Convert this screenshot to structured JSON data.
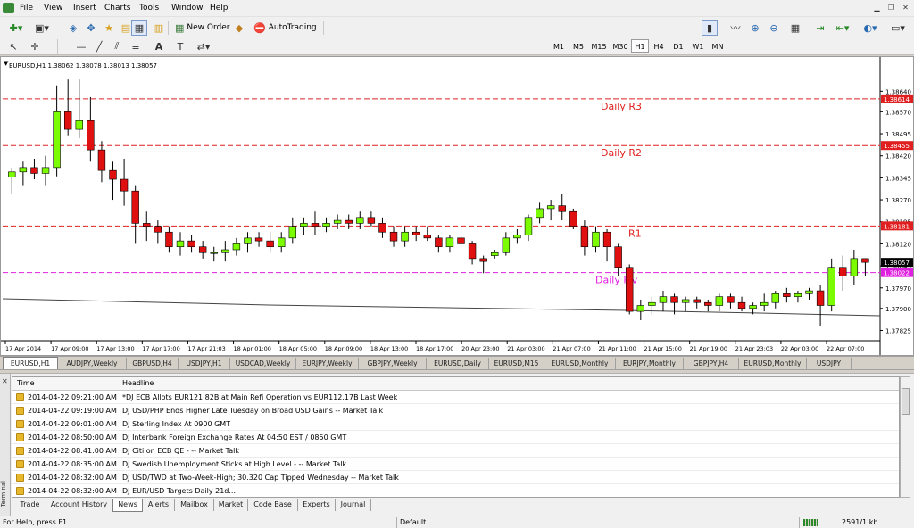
{
  "menu": [
    "File",
    "View",
    "Insert",
    "Charts",
    "Tools",
    "Window",
    "Help"
  ],
  "toolbar": {
    "new_order": "New Order",
    "autotrading": "AutoTrading"
  },
  "timeframes": [
    "M1",
    "M5",
    "M15",
    "M30",
    "H1",
    "H4",
    "D1",
    "W1",
    "MN"
  ],
  "active_timeframe": "H1",
  "chart": {
    "header": "EURUSD,H1  1.38062 1.38078 1.38013 1.38057"
  },
  "chart_data": {
    "type": "candlestick",
    "symbol": "EURUSD",
    "timeframe": "H1",
    "ylim": [
      1.3779,
      1.3872
    ],
    "y_ticks": [
      "1.38640",
      "1.38570",
      "1.38495",
      "1.38420",
      "1.38345",
      "1.38270",
      "1.38195",
      "1.38120",
      "1.38045",
      "1.37970",
      "1.37900",
      "1.37825"
    ],
    "x_ticks": [
      "17 Apr 2014",
      "17 Apr 09:00",
      "17 Apr 13:00",
      "17 Apr 17:00",
      "17 Apr 21:03",
      "18 Apr 01:00",
      "18 Apr 05:00",
      "18 Apr 09:00",
      "18 Apr 13:00",
      "18 Apr 17:00",
      "20 Apr 23:00",
      "21 Apr 03:00",
      "21 Apr 07:00",
      "21 Apr 11:00",
      "21 Apr 15:00",
      "21 Apr 19:00",
      "21 Apr 23:03",
      "22 Apr 03:00",
      "22 Apr 07:00"
    ],
    "levels": [
      {
        "label": "Daily R3",
        "value": 1.38614,
        "price": "1.38614",
        "color": "#e02020"
      },
      {
        "label": "Daily R2",
        "value": 1.38455,
        "price": "1.38455",
        "color": "#e02020"
      },
      {
        "label": "R1",
        "value": 1.38181,
        "price": "1.38181",
        "color": "#e02020"
      },
      {
        "label": "Daily Piv",
        "value": 1.38022,
        "price": "1.38022",
        "color": "#e020e0"
      }
    ],
    "current_price": "1.38057",
    "current_price_value": 1.38057,
    "colors": {
      "bull": "#7CFC00",
      "bear": "#e01010",
      "wick": "#000000"
    },
    "candles": [
      [
        1.38348,
        1.3838,
        1.3829,
        1.38365
      ],
      [
        1.38365,
        1.384,
        1.3832,
        1.3838
      ],
      [
        1.3838,
        1.3841,
        1.3834,
        1.3836
      ],
      [
        1.3836,
        1.3842,
        1.3832,
        1.3838
      ],
      [
        1.3838,
        1.3866,
        1.3835,
        1.3857
      ],
      [
        1.3857,
        1.3868,
        1.3849,
        1.3851
      ],
      [
        1.3851,
        1.3868,
        1.3848,
        1.3854
      ],
      [
        1.3854,
        1.3862,
        1.384,
        1.3844
      ],
      [
        1.3844,
        1.3847,
        1.3833,
        1.3837
      ],
      [
        1.3837,
        1.384,
        1.3827,
        1.3834
      ],
      [
        1.3834,
        1.3841,
        1.3825,
        1.383
      ],
      [
        1.383,
        1.3832,
        1.3812,
        1.3819
      ],
      [
        1.3819,
        1.3823,
        1.3813,
        1.3818
      ],
      [
        1.3818,
        1.382,
        1.3812,
        1.3816
      ],
      [
        1.3816,
        1.3818,
        1.3809,
        1.3811
      ],
      [
        1.3811,
        1.3816,
        1.3808,
        1.3813
      ],
      [
        1.3813,
        1.3815,
        1.3809,
        1.3811
      ],
      [
        1.3811,
        1.3813,
        1.3807,
        1.3809
      ],
      [
        1.3809,
        1.3811,
        1.3806,
        1.3809
      ],
      [
        1.3809,
        1.3813,
        1.3806,
        1.381
      ],
      [
        1.381,
        1.3814,
        1.3808,
        1.3812
      ],
      [
        1.3812,
        1.3816,
        1.3809,
        1.3814
      ],
      [
        1.3814,
        1.3816,
        1.3811,
        1.3813
      ],
      [
        1.3813,
        1.3816,
        1.3809,
        1.3811
      ],
      [
        1.3811,
        1.3816,
        1.3809,
        1.3814
      ],
      [
        1.3814,
        1.3821,
        1.3812,
        1.3818
      ],
      [
        1.3818,
        1.3821,
        1.3815,
        1.3819
      ],
      [
        1.3819,
        1.3823,
        1.3815,
        1.3818
      ],
      [
        1.3818,
        1.3821,
        1.3816,
        1.3819
      ],
      [
        1.3819,
        1.3822,
        1.3817,
        1.382
      ],
      [
        1.382,
        1.3822,
        1.3817,
        1.3819
      ],
      [
        1.3819,
        1.3823,
        1.3817,
        1.3821
      ],
      [
        1.3821,
        1.3823,
        1.3818,
        1.3819
      ],
      [
        1.3819,
        1.3821,
        1.3814,
        1.3816
      ],
      [
        1.3816,
        1.3818,
        1.3811,
        1.3813
      ],
      [
        1.3813,
        1.3818,
        1.3811,
        1.3816
      ],
      [
        1.3816,
        1.3818,
        1.3813,
        1.3815
      ],
      [
        1.3815,
        1.3818,
        1.3813,
        1.3814
      ],
      [
        1.3814,
        1.3815,
        1.3809,
        1.3811
      ],
      [
        1.3811,
        1.3815,
        1.3809,
        1.3814
      ],
      [
        1.3814,
        1.3815,
        1.381,
        1.3812
      ],
      [
        1.3812,
        1.3813,
        1.3805,
        1.3807
      ],
      [
        1.3807,
        1.3808,
        1.3802,
        1.3806
      ],
      [
        1.3808,
        1.381,
        1.3807,
        1.3809
      ],
      [
        1.3809,
        1.3816,
        1.3808,
        1.3814
      ],
      [
        1.3814,
        1.3817,
        1.3812,
        1.3815
      ],
      [
        1.3815,
        1.3822,
        1.3813,
        1.3821
      ],
      [
        1.3821,
        1.3826,
        1.3819,
        1.3824
      ],
      [
        1.3824,
        1.3827,
        1.382,
        1.3825
      ],
      [
        1.3825,
        1.3829,
        1.382,
        1.3823
      ],
      [
        1.3823,
        1.3824,
        1.3817,
        1.3818
      ],
      [
        1.3818,
        1.382,
        1.3808,
        1.3811
      ],
      [
        1.3811,
        1.3818,
        1.3809,
        1.3816
      ],
      [
        1.3816,
        1.3817,
        1.3806,
        1.3811
      ],
      [
        1.3811,
        1.3812,
        1.3801,
        1.3804
      ],
      [
        1.3804,
        1.3805,
        1.3788,
        1.3789
      ],
      [
        1.3789,
        1.3793,
        1.3786,
        1.3791
      ],
      [
        1.3791,
        1.3794,
        1.3788,
        1.3792
      ],
      [
        1.3792,
        1.3796,
        1.3789,
        1.3794
      ],
      [
        1.3794,
        1.3795,
        1.3788,
        1.3792
      ],
      [
        1.3792,
        1.3794,
        1.3789,
        1.3793
      ],
      [
        1.3793,
        1.3794,
        1.379,
        1.3792
      ],
      [
        1.3792,
        1.3793,
        1.3789,
        1.3791
      ],
      [
        1.3791,
        1.3795,
        1.3789,
        1.3794
      ],
      [
        1.3794,
        1.3795,
        1.379,
        1.3792
      ],
      [
        1.3792,
        1.3794,
        1.3789,
        1.379
      ],
      [
        1.379,
        1.3792,
        1.3788,
        1.3791
      ],
      [
        1.3791,
        1.3795,
        1.3789,
        1.3792
      ],
      [
        1.3792,
        1.3796,
        1.379,
        1.3795
      ],
      [
        1.3795,
        1.3797,
        1.3792,
        1.3794
      ],
      [
        1.3794,
        1.3796,
        1.3792,
        1.3795
      ],
      [
        1.3795,
        1.3797,
        1.3793,
        1.3796
      ],
      [
        1.3796,
        1.3798,
        1.3784,
        1.3791
      ],
      [
        1.3791,
        1.3807,
        1.3789,
        1.3804
      ],
      [
        1.3804,
        1.3808,
        1.3796,
        1.3801
      ],
      [
        1.3801,
        1.381,
        1.3798,
        1.3807
      ],
      [
        1.3807,
        1.3807,
        1.3801,
        1.38057
      ]
    ]
  },
  "symbol_tabs": [
    "EURUSD,H1",
    "AUDJPY,Weekly",
    "GBPUSD,H4",
    "USDJPY,H1",
    "USDCAD,Weekly",
    "EURJPY,Weekly",
    "GBPJPY,Weekly",
    "EURUSD,Daily",
    "EURUSD,M15",
    "EURUSD,Monthly",
    "EURJPY,Monthly",
    "GBPJPY,H4",
    "EURUSD,Monthly",
    "USDJPY"
  ],
  "news": {
    "col_time": "Time",
    "col_headline": "Headline",
    "rows": [
      {
        "time": "2014-04-22 09:21:00 AM",
        "headline": "*DJ ECB Allots EUR121.82B at Main Refi Operation vs EUR112.17B Last Week"
      },
      {
        "time": "2014-04-22 09:19:00 AM",
        "headline": "DJ USD/PHP Ends Higher Late Tuesday on Broad USD Gains -- Market Talk"
      },
      {
        "time": "2014-04-22 09:01:00 AM",
        "headline": "DJ Sterling Index At 0900 GMT"
      },
      {
        "time": "2014-04-22 08:50:00 AM",
        "headline": "DJ Interbank Foreign Exchange Rates At 04:50 EST / 0850 GMT"
      },
      {
        "time": "2014-04-22 08:41:00 AM",
        "headline": "DJ Citi on ECB QE - -- Market Talk"
      },
      {
        "time": "2014-04-22 08:35:00 AM",
        "headline": "DJ Swedish Unemployment Sticks at High Level - -- Market Talk"
      },
      {
        "time": "2014-04-22 08:32:00 AM",
        "headline": "DJ USD/TWD at Two-Week-High; 30.320 Cap Tipped Wednesday -- Market Talk"
      },
      {
        "time": "2014-04-22 08:32:00 AM",
        "headline": "DJ EUR/USD Targets Daily 21d..."
      }
    ]
  },
  "terminal": {
    "side_label": "Terminal",
    "tabs": [
      "Trade",
      "Account History",
      "News",
      "Alerts",
      "Mailbox",
      "Market",
      "Code Base",
      "Experts",
      "Journal"
    ],
    "active_tab": "News"
  },
  "status": {
    "help": "For Help, press F1",
    "profile": "Default",
    "traffic": "2591/1 kb"
  }
}
